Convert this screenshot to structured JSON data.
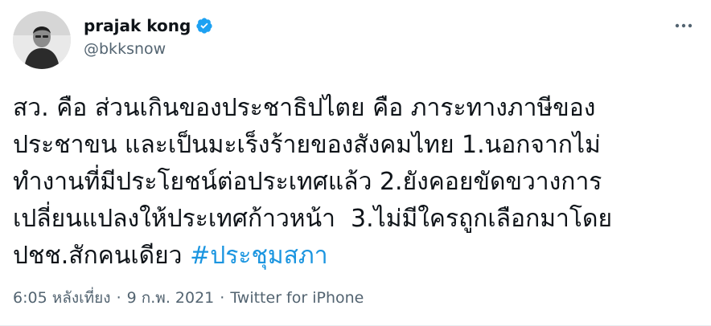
{
  "author": {
    "display_name": "prajak kong",
    "handle": "@bkksnow",
    "verified_icon": "verified-badge-icon",
    "avatar_icon": "avatar"
  },
  "menu": {
    "icon": "more-options-icon"
  },
  "tweet": {
    "text_lines": [
      "สว. คือ ส่วนเกินของประชาธิปไตย คือ ภาระทางภาษีของ",
      "ประชาขน และเป็นมะเร็งร้ายของสังคมไทย 1.นอกจากไม่",
      "ทำงานที่มีประโยชน์ต่อประเทศแล้ว 2.ยังคอยขัดขวางการ",
      "เปลี่ยนแปลงให้ประเทศก้าวหน้า  3.ไม่มีใครถูกเลือกมาโดย",
      "ปชช.สักคนเดียว "
    ],
    "hashtag": "#ประชุมสภา"
  },
  "meta": {
    "time": "6:05 หลังเที่ยง",
    "separator": "·",
    "date": "9 ก.พ. 2021",
    "source": "Twitter for iPhone"
  },
  "colors": {
    "hashtag": "#1b95e0",
    "verified": "#1da1f2",
    "secondary_text": "#536471"
  }
}
